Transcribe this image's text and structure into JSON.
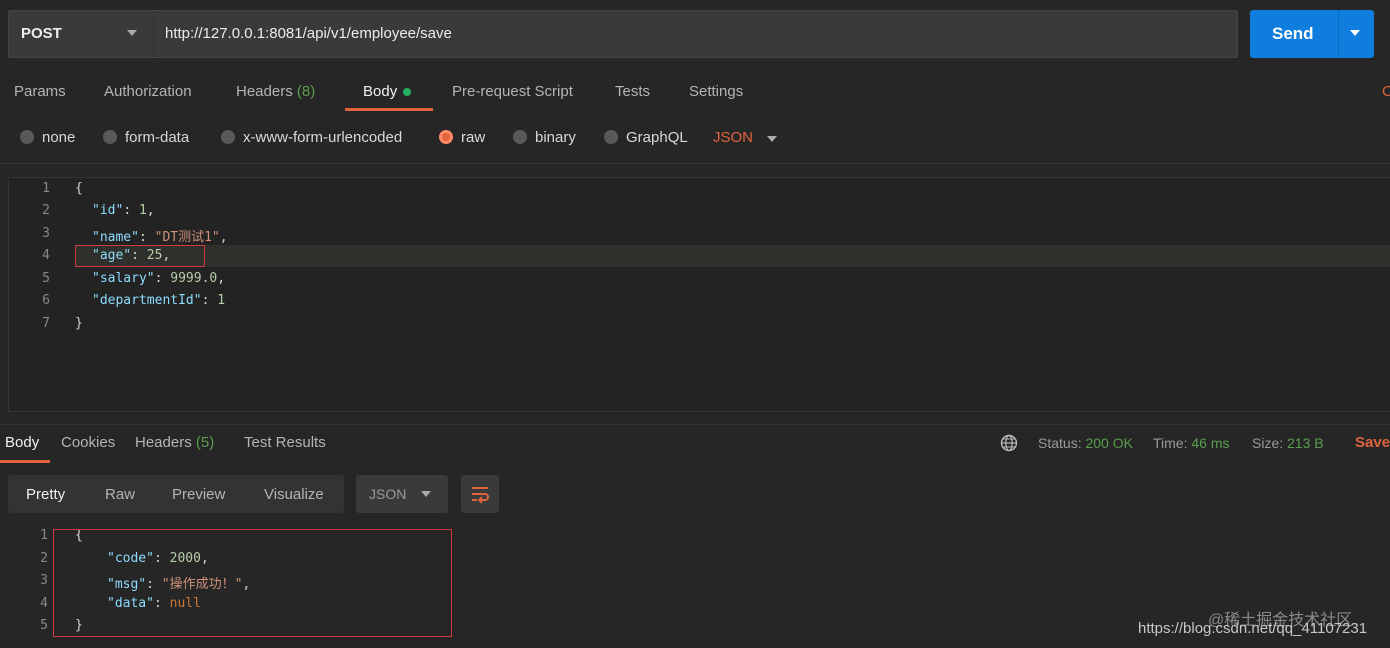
{
  "request": {
    "method": "POST",
    "url": "http://127.0.0.1:8081/api/v1/employee/save",
    "send_label": "Send"
  },
  "request_tabs": {
    "params": "Params",
    "authorization": "Authorization",
    "headers": "Headers",
    "headers_count": "(8)",
    "body": "Body",
    "prerequest": "Pre-request Script",
    "tests": "Tests",
    "settings": "Settings",
    "cut_label": "C"
  },
  "body_types": {
    "none": "none",
    "form_data": "form-data",
    "urlencoded": "x-www-form-urlencoded",
    "raw": "raw",
    "binary": "binary",
    "graphql": "GraphQL",
    "format": "JSON",
    "selected": "raw"
  },
  "request_body": {
    "line_numbers": [
      "1",
      "2",
      "3",
      "4",
      "5",
      "6",
      "7"
    ],
    "l1": "{",
    "id_key": "\"id\"",
    "id_val": "1",
    "name_key": "\"name\"",
    "name_val": "\"DT测试1\"",
    "age_key": "\"age\"",
    "age_val": "25",
    "salary_key": "\"salary\"",
    "salary_val": "9999.0",
    "dept_key": "\"departmentId\"",
    "dept_val": "1",
    "l7": "}"
  },
  "response_tabs": {
    "body": "Body",
    "cookies": "Cookies",
    "headers": "Headers",
    "headers_count": "(5)",
    "test_results": "Test Results"
  },
  "response_meta": {
    "status_label": "Status:",
    "status_value": "200 OK",
    "time_label": "Time:",
    "time_value": "46 ms",
    "size_label": "Size:",
    "size_value": "213 B",
    "save_label": "Save"
  },
  "view_tabs": {
    "pretty": "Pretty",
    "raw": "Raw",
    "preview": "Preview",
    "visualize": "Visualize",
    "format": "JSON"
  },
  "response_body": {
    "line_numbers": [
      "1",
      "2",
      "3",
      "4",
      "5"
    ],
    "l1": "{",
    "code_key": "\"code\"",
    "code_val": "2000",
    "msg_key": "\"msg\"",
    "msg_val": "\"操作成功！\"",
    "data_key": "\"data\"",
    "data_val": "null",
    "l5": "}"
  },
  "watermark": {
    "line1": "@稀土掘金技术社区",
    "line2": "https://blog.csdn.net/qq_41107231"
  },
  "colors": {
    "accent": "#e0643c",
    "send": "#0e7dde",
    "success": "#5b9e4d"
  }
}
